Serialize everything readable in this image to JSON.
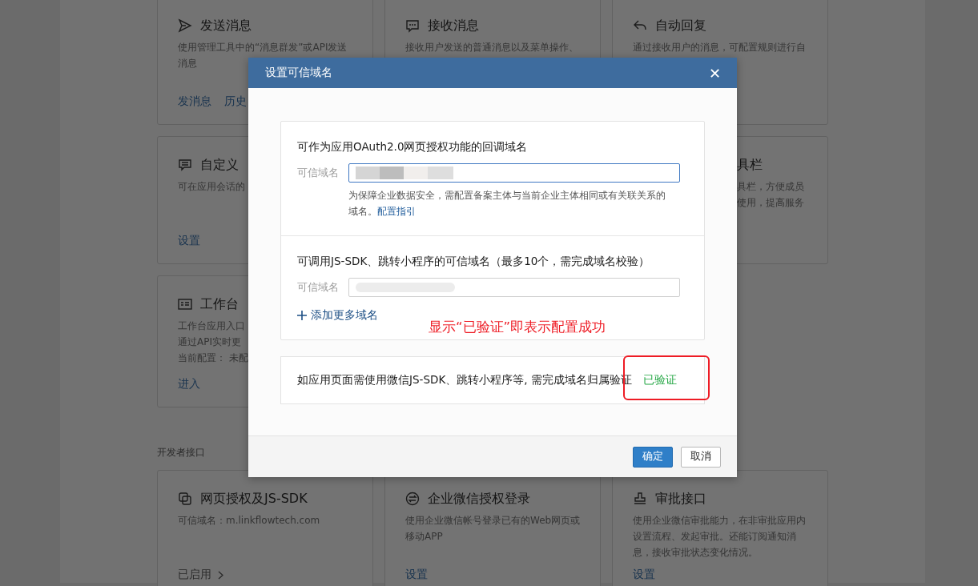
{
  "cards": [
    {
      "kind": "full",
      "title": "发送消息",
      "description": [
        "使用管理工具中的“消息群发”或API发送",
        "消息"
      ],
      "links": [
        "发消息",
        "历史"
      ]
    },
    {
      "kind": "full",
      "title": "接收消息",
      "description": [
        "接收用户发送的普通消息以及菜单操作、"
      ]
    },
    {
      "kind": "full",
      "title": "自动回复",
      "description": [
        "通过接收用户的消息，可配置规则进行自"
      ]
    },
    {
      "kind": "full",
      "title": "自定义",
      "description": [
        "可在应用会话的"
      ],
      "links": [
        "设置"
      ]
    },
    {
      "kind": "spacer"
    },
    {
      "kind": "partly_hidden",
      "title": "具栏",
      "description": [
        "具栏，方便成员",
        "使用，提高服务"
      ]
    },
    {
      "kind": "full",
      "title": "工作台",
      "description": [
        "工作台应用入口",
        "通过API实时更",
        "当前配置：  未配"
      ],
      "links": [
        "进入"
      ]
    }
  ],
  "section_label": "开发者接口",
  "dev_cards": [
    {
      "kind": "full",
      "title": "网页授权及JS-SDK",
      "description": [
        "可信域名：m.linkflowtech.com"
      ],
      "links": [
        "已启用"
      ],
      "status_arrow": true
    },
    {
      "kind": "full",
      "title": "企业微信授权登录",
      "description": [
        "使用企业微信帐号登录已有的Web网页或",
        "移动APP"
      ],
      "links": [
        "设置"
      ],
      "status_arrow": false
    },
    {
      "kind": "full",
      "title": "审批接口",
      "description": [
        "使用企业微信审批能力，在非审批应用内",
        "设置流程、发起审批。还能订阅通知消",
        "息，接收审批状态变化情况。"
      ],
      "links": [
        "设置"
      ],
      "status_arrow": false
    }
  ],
  "dialog": {
    "title": "设置可信域名",
    "close": "✕",
    "oauth": {
      "heading": "可作为应用OAuth2.0网页授权功能的回调域名",
      "label": "可信域名",
      "focused": true,
      "hint": "为保障企业数据安全，需配置备案主体与当前企业主体相同或有关联关系的域名。",
      "hint_link": "配置指引"
    },
    "jssdk": {
      "heading": "可调用JS-SDK、跳转小程序的可信域名（最多10个，需完成域名校验）",
      "label": "可信域名",
      "focused": false,
      "add": "添加更多域名"
    },
    "annotation": "显示“已验证”即表示配置成功",
    "verify": {
      "text": "如应用页面需使用微信JS-SDK、跳转小程序等, 需完成域名归属验证",
      "status": "已验证",
      "verified": true,
      "highlighted": true
    },
    "buttons": [
      {
        "label": "确定",
        "primary": true
      },
      {
        "label": "取消",
        "primary": false
      }
    ]
  }
}
